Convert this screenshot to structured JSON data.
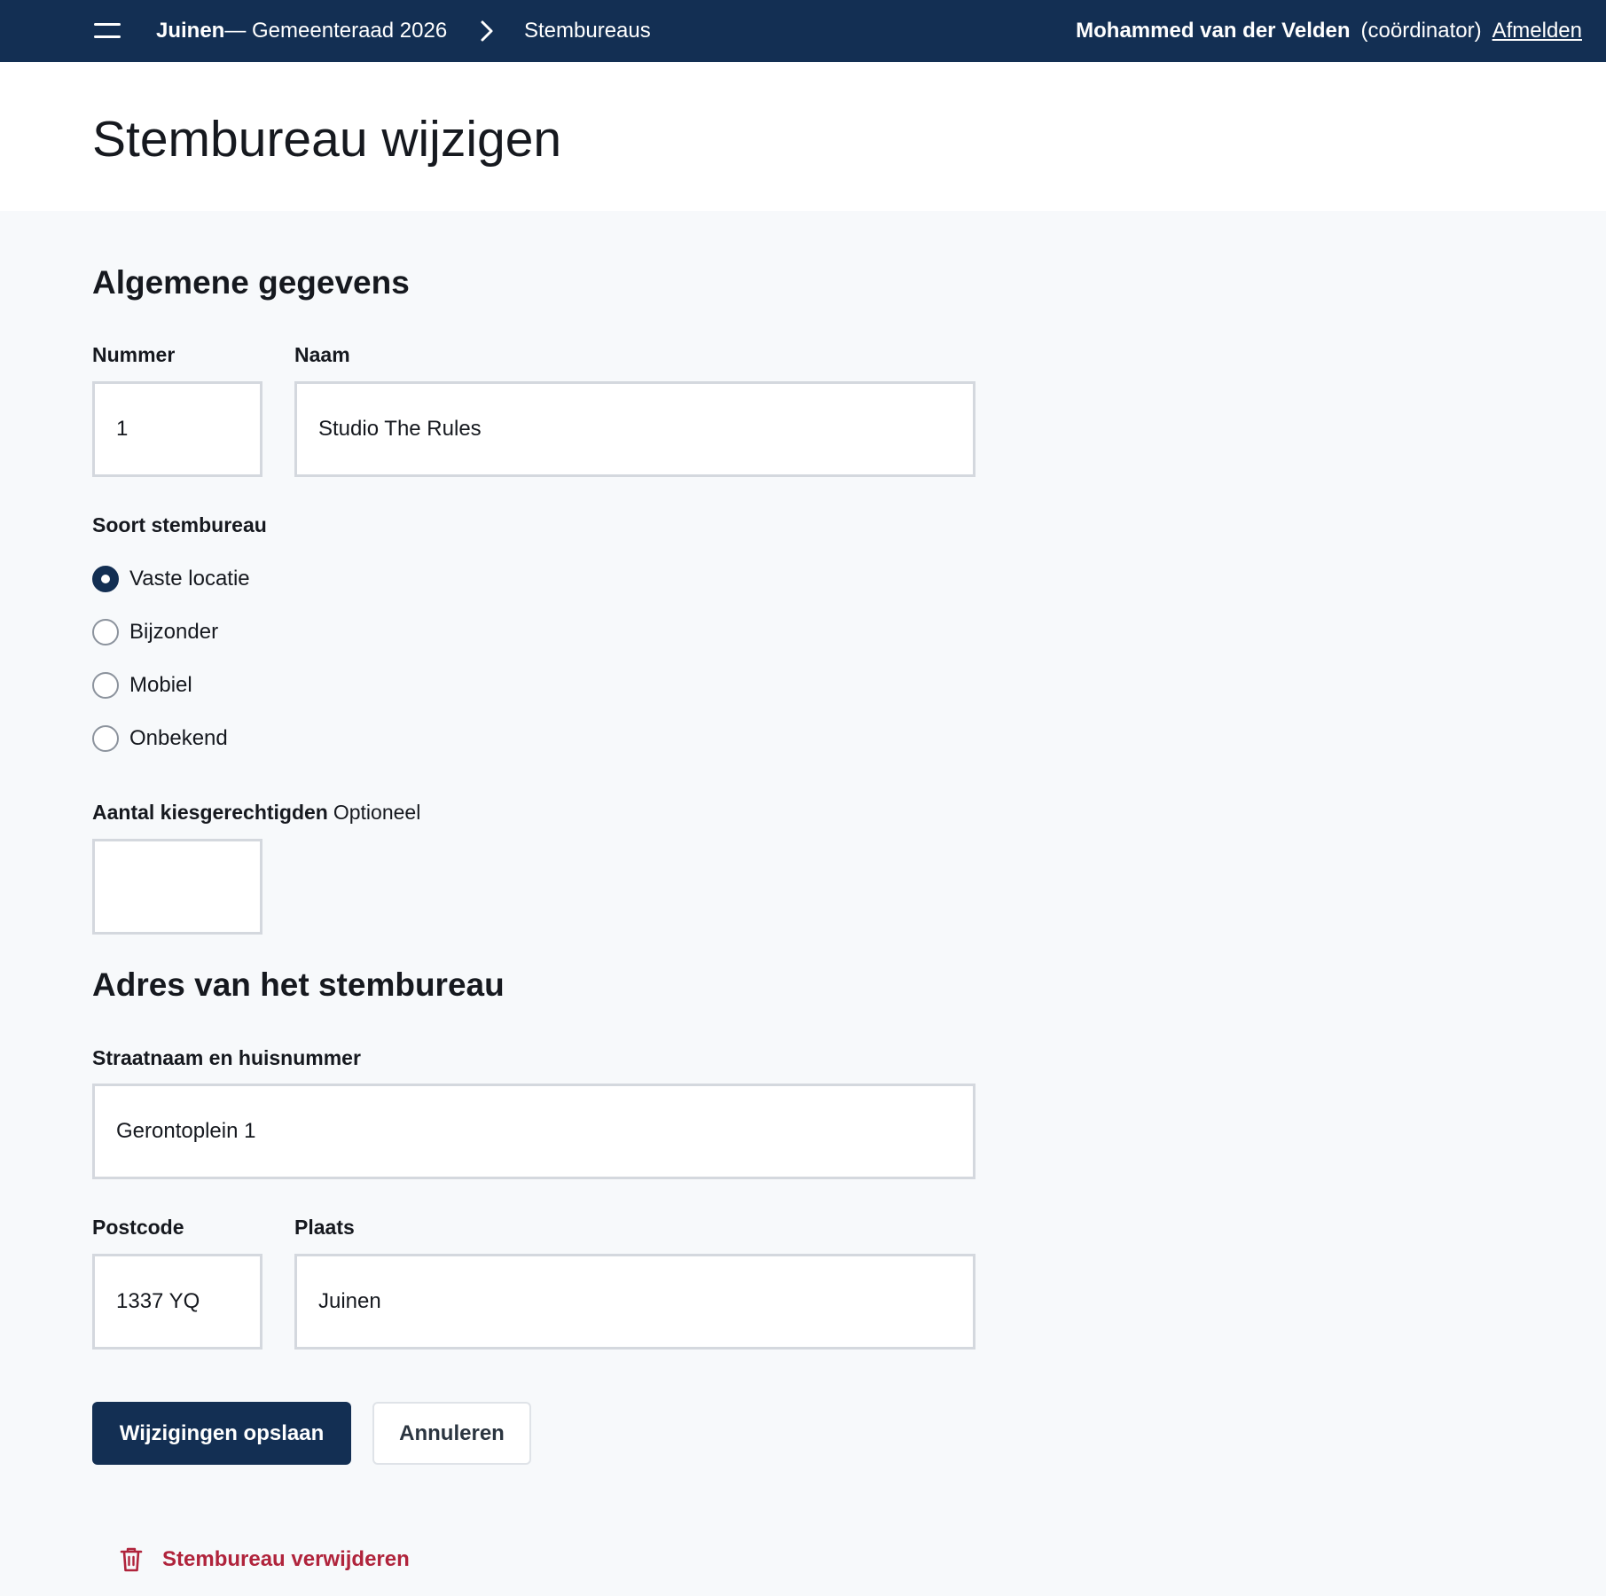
{
  "nav": {
    "municipality": "Juinen",
    "election": " — Gemeenteraad 2026",
    "current_section": "Stembureaus"
  },
  "user": {
    "name": "Mohammed van der Velden",
    "role": "(coördinator)",
    "logout_label": "Afmelden"
  },
  "page": {
    "title": "Stembureau wijzigen"
  },
  "general": {
    "heading": "Algemene gegevens",
    "number_label": "Nummer",
    "number_value": "1",
    "name_label": "Naam",
    "name_value": "Studio The Rules",
    "type_label": "Soort stembureau",
    "type_options": [
      {
        "label": "Vaste locatie",
        "checked": true
      },
      {
        "label": "Bijzonder",
        "checked": false
      },
      {
        "label": "Mobiel",
        "checked": false
      },
      {
        "label": "Onbekend",
        "checked": false
      }
    ],
    "voters_label": "Aantal kiesgerechtigden",
    "voters_optional": "Optioneel",
    "voters_value": ""
  },
  "address": {
    "heading": "Adres van het stembureau",
    "street_label": "Straatnaam en huisnummer",
    "street_value": "Gerontoplein 1",
    "postcode_label": "Postcode",
    "postcode_value": "1337 YQ",
    "city_label": "Plaats",
    "city_value": "Juinen"
  },
  "actions": {
    "save_label": "Wijzigingen opslaan",
    "cancel_label": "Annuleren",
    "delete_label": "Stembureau verwijderen"
  },
  "icons": {
    "menu": "hamburger-icon",
    "breadcrumb_separator": "chevron-right-icon",
    "delete": "trash-icon"
  },
  "colors": {
    "navbar": "#132f53",
    "primary_button": "#132f53",
    "danger": "#b0243c",
    "page_background": "#f7f9fb"
  }
}
